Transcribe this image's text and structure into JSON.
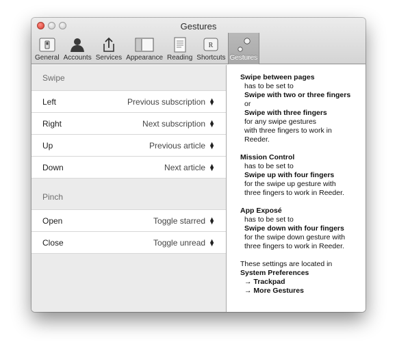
{
  "window": {
    "title": "Gestures"
  },
  "toolbar": {
    "items": [
      {
        "label": "General",
        "icon": "switch-icon"
      },
      {
        "label": "Accounts",
        "icon": "person-icon"
      },
      {
        "label": "Services",
        "icon": "share-icon"
      },
      {
        "label": "Appearance",
        "icon": "window-icon"
      },
      {
        "label": "Reading",
        "icon": "document-icon"
      },
      {
        "label": "Shortcuts",
        "icon": "key-icon",
        "key": "R"
      },
      {
        "label": "Gestures",
        "icon": "gestures-icon",
        "selected": true
      }
    ]
  },
  "swipe": {
    "header": "Swipe",
    "rows": [
      {
        "label": "Left",
        "value": "Previous subscription"
      },
      {
        "label": "Right",
        "value": "Next subscription"
      },
      {
        "label": "Up",
        "value": "Previous article"
      },
      {
        "label": "Down",
        "value": "Next article"
      }
    ]
  },
  "pinch": {
    "header": "Pinch",
    "rows": [
      {
        "label": "Open",
        "value": "Toggle starred"
      },
      {
        "label": "Close",
        "value": "Toggle unread"
      }
    ]
  },
  "info": {
    "p1": {
      "title": "Swipe between pages",
      "l1": "has to be set to",
      "l2": "Swipe with two or three fingers",
      "l3": "or",
      "l4": "Swipe with three fingers",
      "l5": "for any swipe gestures",
      "l6": "with three fingers to work in",
      "l7": "Reeder."
    },
    "p2": {
      "title": "Mission Control",
      "l1": "has to be set to",
      "l2": "Swipe up with four fingers",
      "l3": "for the swipe up gesture with",
      "l4": "three fingers to work in Reeder."
    },
    "p3": {
      "title": "App Exposé",
      "l1": "has to be set to",
      "l2": "Swipe down with four fingers",
      "l3": "for the swipe down gesture with",
      "l4": "three fingers to work in Reeder."
    },
    "p4": {
      "l1": "These settings are located in",
      "l2": "System Preferences",
      "l3": "→ Trackpad",
      "l4": "→ More Gestures"
    }
  }
}
